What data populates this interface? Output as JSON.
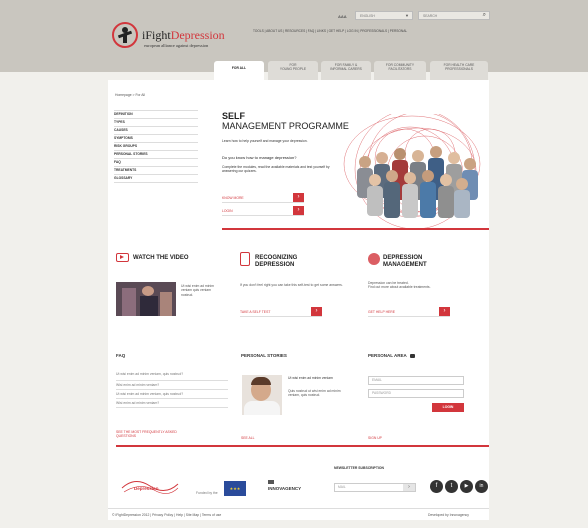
{
  "header": {
    "logo_text_i": "i",
    "logo_text_fight": "Fight",
    "logo_text_depression": "Depression",
    "logo_tagline": "european alliance against depression",
    "font_size_control": "AAA",
    "language": "ENGLISH",
    "search_placeholder": "SEARCH",
    "top_links": "TOOLS | ABOUT US | RESOURCES | FAQ | LINKS | GET HELP | LOG IN | PROFESSIONALS  | PERSONAL"
  },
  "tabs": [
    {
      "label": "FOR ALL"
    },
    {
      "label": "FOR\nYOUNG PEOPLE"
    },
    {
      "label": "FOR FAMILY &\nINFORMAL CARERS"
    },
    {
      "label": "FOR COMMUNITY\nFACILITATORS"
    },
    {
      "label": "FOR HEALTH CARE\nPROFESSIONALS"
    }
  ],
  "breadcrumb": "Homepage > For All",
  "sidebar": {
    "items": [
      "DEFINITION",
      "TYPES",
      "CAUSES",
      "SYMPTOMS",
      "RISK GROUPS",
      "PERSONAL STORIES",
      "FAQ",
      "TREATMENTS",
      "GLOSSARY"
    ]
  },
  "hero": {
    "title_line1": "SELF",
    "title_line2": "MANAGEMENT PROGRAMME",
    "p1": "Learn how to help yourself and manage your depression.",
    "p2": "Do you know how to manage depression?",
    "p3": "Complete the modules, read the available materials and test yourself by answering our quizzes.",
    "btn1": "KNOW MORE",
    "btn2": "LOGIN"
  },
  "video": {
    "title": "WATCH THE VIDEO",
    "caption": "Ut wisi enim ad minim veniam quis veniam nostrud."
  },
  "recognizing": {
    "title": "RECOGNIZING\nDEPRESSION",
    "text": "If you don't feel right you can take this self-test to get some answers.",
    "link": "TAKE A SELF TEST"
  },
  "management": {
    "title": "DEPRESSION\nMANAGEMENT",
    "text": "Depression can be treated.\nFind out more about available treatments.",
    "link": "GET HELP HERE"
  },
  "faq": {
    "title": "FAQ",
    "items": [
      "Ut wisi enim ad minim veniam, quis nostrud?",
      "Wisi enim ad minim veniam?",
      "Ut wisi enim ad minim veniam, quis nostrud?",
      "Wisi enim ad minim veniam?"
    ],
    "more_link": "SEE THE MOST FREQUENTLY ASKED QUESTIONS"
  },
  "stories": {
    "title": "PERSONAL STORIES",
    "quote": "Ut wisi enim ad minim veniam",
    "text": "Quis nostrud ut wisi enim ad minim veniam, quis nostrud.",
    "link": "SEE ALL"
  },
  "personal_area": {
    "title": "PERSONAL AREA",
    "email_placeholder": "EMAIL",
    "password_placeholder": "PASSWORD",
    "login_btn": "LOGIN",
    "signup": "SIGN UP"
  },
  "footer": {
    "funded_by": "Funded by the",
    "innovagency": "INNOVAGENCY",
    "newsletter_title": "NEWSLETTER SUBSCRIPTION",
    "newsletter_placeholder": "MAIL",
    "copyright": "© iFightDepression 2012   |   Privacy Policy   |   Help   |   Site Map   |   Terms of use",
    "developed": "Developed by Innovagency",
    "social": [
      "f",
      "t",
      "▶",
      "in"
    ]
  },
  "colors": {
    "accent": "#d2363c",
    "header_bg": "#c9c6bf",
    "page_bg": "#f1f0ec"
  }
}
